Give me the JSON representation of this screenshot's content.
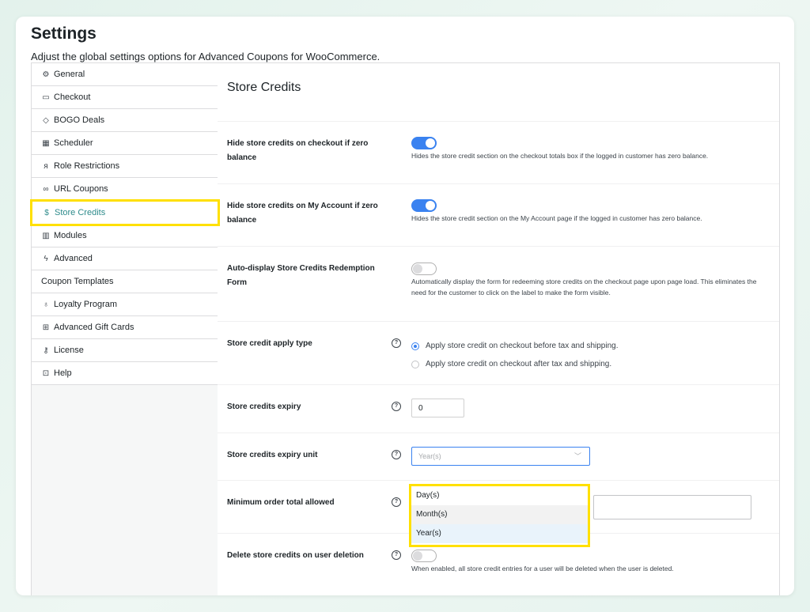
{
  "page": {
    "title": "Settings",
    "description": "Adjust the global settings options for Advanced Coupons for WooCommerce."
  },
  "sidebar": {
    "items": [
      {
        "label": "General",
        "icon": "gear-icon"
      },
      {
        "label": "Checkout",
        "icon": "card-icon"
      },
      {
        "label": "BOGO Deals",
        "icon": "tag-icon"
      },
      {
        "label": "Scheduler",
        "icon": "calendar-icon"
      },
      {
        "label": "Role Restrictions",
        "icon": "user-icon"
      },
      {
        "label": "URL Coupons",
        "icon": "link-icon"
      },
      {
        "label": "Store Credits",
        "icon": "dollar-icon",
        "active": true
      },
      {
        "label": "Modules",
        "icon": "modules-icon"
      },
      {
        "label": "Advanced",
        "icon": "bolt-icon"
      },
      {
        "label": "Coupon Templates",
        "icon": ""
      },
      {
        "label": "Loyalty Program",
        "icon": "badge-icon"
      },
      {
        "label": "Advanced Gift Cards",
        "icon": "gift-icon"
      },
      {
        "label": "License",
        "icon": "key-icon"
      },
      {
        "label": "Help",
        "icon": "help-box-icon"
      }
    ]
  },
  "main": {
    "section_title": "Store Credits",
    "hide_checkout": {
      "label": "Hide store credits on checkout if zero balance",
      "enabled": true,
      "description": "Hides the store credit section on the checkout totals box if the logged in customer has zero balance."
    },
    "hide_my_account": {
      "label": "Hide store credits on My Account if zero balance",
      "enabled": true,
      "description": "Hides the store credit section on the My Account page if the logged in customer has zero balance."
    },
    "auto_display": {
      "label": "Auto-display Store Credits Redemption Form",
      "enabled": false,
      "description": "Automatically display the form for redeeming store credits on the checkout page upon page load. This eliminates the need for the customer to click on the label to make the form visible."
    },
    "apply_type": {
      "label": "Store credit apply type",
      "options": [
        "Apply store credit on checkout before tax and shipping.",
        "Apply store credit on checkout after tax and shipping."
      ],
      "selected": 0
    },
    "expiry": {
      "label": "Store credits expiry",
      "value": "0"
    },
    "expiry_unit": {
      "label": "Store credits expiry unit",
      "selected": "Year(s)",
      "options": [
        "Day(s)",
        "Month(s)",
        "Year(s)"
      ]
    },
    "min_order": {
      "label": "Minimum order total allowed",
      "value": ""
    },
    "delete_on_user_deletion": {
      "label": "Delete store credits on user deletion",
      "enabled": false,
      "description": "When enabled, all store credit entries for a user will be deleted when the user is deleted."
    }
  },
  "colors": {
    "accent": "#3a82f0",
    "active_nav": "#2e8b8b",
    "highlight": "#ffe000"
  }
}
